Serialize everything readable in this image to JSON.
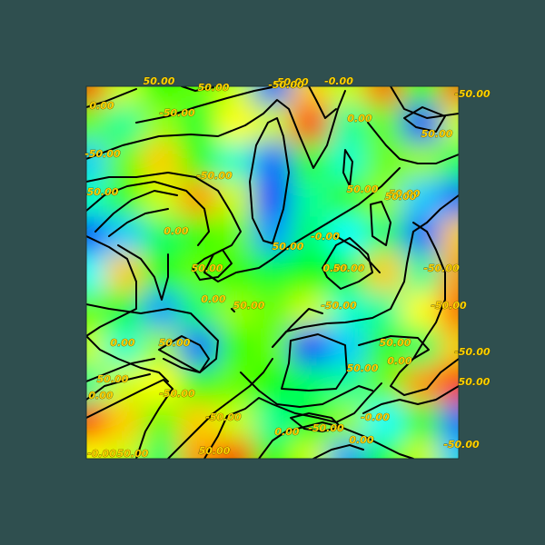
{
  "chart_data": {
    "type": "heatmap",
    "title": "",
    "xlabel": "",
    "ylabel": "",
    "colormap": [
      "#0000ff",
      "#00ffff",
      "#00ff00",
      "#ffff00",
      "#ff0000"
    ],
    "value_range": [
      -100,
      100
    ],
    "contour_levels": [
      -50,
      0,
      50
    ],
    "grid": "11x11",
    "z": [
      [
        90,
        40,
        10,
        20,
        40,
        -80,
        60,
        40,
        80,
        10,
        80
      ],
      [
        20,
        -30,
        30,
        -10,
        50,
        40,
        90,
        -30,
        20,
        -90,
        40
      ],
      [
        -60,
        20,
        60,
        10,
        -40,
        -80,
        10,
        -40,
        20,
        30,
        -20
      ],
      [
        -40,
        10,
        40,
        70,
        40,
        -90,
        -30,
        10,
        30,
        -60,
        -80
      ],
      [
        -90,
        -60,
        -20,
        10,
        20,
        -70,
        -20,
        -50,
        -20,
        -80,
        60
      ],
      [
        -50,
        60,
        0,
        20,
        10,
        -10,
        0,
        -10,
        60,
        -30,
        70
      ],
      [
        20,
        -10,
        -70,
        -20,
        30,
        20,
        40,
        -40,
        -30,
        50,
        80
      ],
      [
        40,
        -40,
        30,
        -80,
        10,
        20,
        -90,
        -60,
        10,
        -20,
        60
      ],
      [
        -30,
        40,
        50,
        10,
        20,
        0,
        -20,
        -30,
        20,
        70,
        90
      ],
      [
        90,
        60,
        20,
        60,
        40,
        -30,
        0,
        30,
        -50,
        10,
        -80
      ],
      [
        50,
        40,
        -20,
        70,
        90,
        0,
        40,
        -70,
        -10,
        40,
        -60
      ]
    ],
    "labels": [
      {
        "text": "50.00"
      },
      {
        "text": "50.00"
      },
      {
        "text": "-50.00"
      },
      {
        "text": "-50.00"
      },
      {
        "text": "-0.00"
      },
      {
        "text": "-50.00"
      },
      {
        "text": "0.00"
      },
      {
        "text": "-50.00"
      },
      {
        "text": "0.00"
      },
      {
        "text": "50.00"
      },
      {
        "text": "-50.00"
      },
      {
        "text": "-50.00"
      },
      {
        "text": "50.00"
      },
      {
        "text": "50.00"
      },
      {
        "text": "50.00"
      },
      {
        "text": "50.00"
      },
      {
        "text": "0.00"
      },
      {
        "text": "50.00"
      },
      {
        "text": "-0.00"
      },
      {
        "text": "50.00"
      },
      {
        "text": "0.00"
      },
      {
        "text": "0.00"
      },
      {
        "text": "50.00"
      },
      {
        "text": "-50.00"
      },
      {
        "text": "50.00"
      },
      {
        "text": "-50.00"
      },
      {
        "text": "-50.00"
      },
      {
        "text": "0.00"
      },
      {
        "text": "50.00"
      },
      {
        "text": "50.00"
      },
      {
        "text": "-50.00"
      },
      {
        "text": "50.00"
      },
      {
        "text": "0.00"
      },
      {
        "text": "50.00"
      },
      {
        "text": "50.00"
      },
      {
        "text": "-50.00"
      },
      {
        "text": "0.00"
      },
      {
        "text": "-50.00"
      },
      {
        "text": "-0.00"
      },
      {
        "text": "0.00"
      },
      {
        "text": "-50.00"
      },
      {
        "text": "-0.00"
      },
      {
        "text": "50.00"
      },
      {
        "text": "50.00"
      },
      {
        "text": "0.00"
      },
      {
        "text": "-50.00"
      }
    ]
  }
}
